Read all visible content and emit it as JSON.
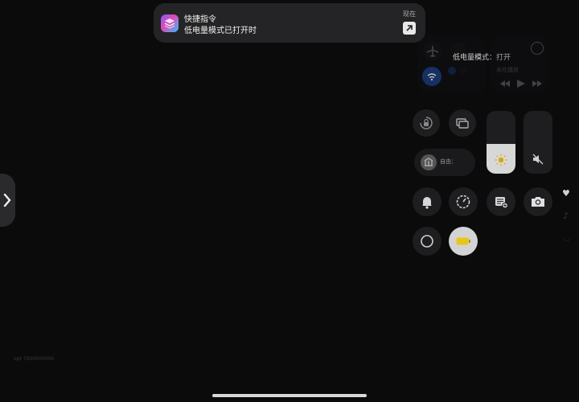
{
  "notification": {
    "app_name": "快捷指令",
    "message": "低电量模式已打开时",
    "time": "现在",
    "app_icon": "shortcuts-icon",
    "action_icon": "open-arrow-icon"
  },
  "control_center": {
    "status_message": "低电量模式：打开",
    "focus_label": "自由：",
    "media_label": "未在播放",
    "brightness_level": 0.47,
    "volume_level": 0,
    "low_power_mode": true,
    "accent_color": "#1a5fd6",
    "battery_color": "#e8c51a"
  },
  "background": {
    "corner_label": "opt  7000000000"
  },
  "colors": {
    "background": "#0b0b0c",
    "banner": "#242426"
  }
}
